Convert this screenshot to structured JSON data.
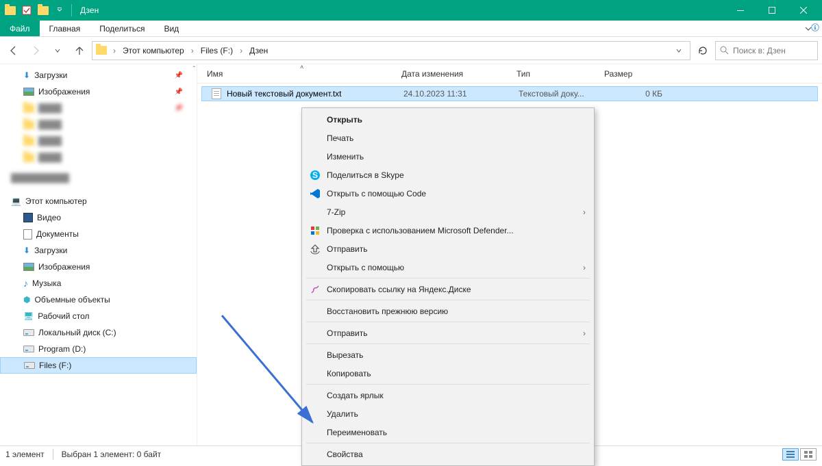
{
  "window": {
    "title": "Дзен"
  },
  "tabs": {
    "file": "Файл",
    "home": "Главная",
    "share": "Поделиться",
    "view": "Вид"
  },
  "breadcrumb": {
    "root": "Этот компьютер",
    "drive": "Files (F:)",
    "folder": "Дзен"
  },
  "search": {
    "placeholder": "Поиск в: Дзен"
  },
  "columns": {
    "name": "Имя",
    "date": "Дата изменения",
    "type": "Тип",
    "size": "Размер"
  },
  "file": {
    "name": "Новый текстовый документ.txt",
    "date": "24.10.2023 11:31",
    "type": "Текстовый доку...",
    "size": "0 КБ"
  },
  "sidebar": {
    "downloads": "Загрузки",
    "pictures": "Изображения",
    "thisPc": "Этот компьютер",
    "videos": "Видео",
    "documents": "Документы",
    "downloads2": "Загрузки",
    "pictures2": "Изображения",
    "music": "Музыка",
    "objects3d": "Объемные объекты",
    "desktop": "Рабочий стол",
    "localC": "Локальный диск (C:)",
    "programD": "Program (D:)",
    "filesF": "Files (F:)"
  },
  "status": {
    "count": "1 элемент",
    "selection": "Выбран 1 элемент: 0 байт"
  },
  "ctx": {
    "open": "Открыть",
    "print": "Печать",
    "edit": "Изменить",
    "skype": "Поделиться в Skype",
    "vscode": "Открыть с помощью Code",
    "sevenZip": "7-Zip",
    "defender": "Проверка с использованием Microsoft Defender...",
    "share": "Отправить",
    "openWith": "Открыть с помощью",
    "yandex": "Скопировать ссылку на Яндекс.Диске",
    "restore": "Восстановить прежнюю версию",
    "sendTo": "Отправить",
    "cut": "Вырезать",
    "copy": "Копировать",
    "shortcut": "Создать ярлык",
    "delete": "Удалить",
    "rename": "Переименовать",
    "properties": "Свойства"
  }
}
